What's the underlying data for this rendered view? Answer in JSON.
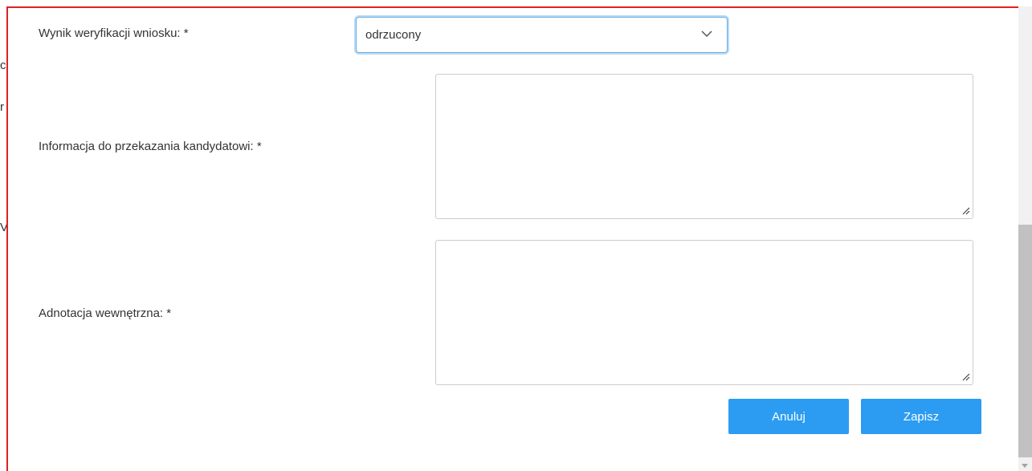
{
  "form": {
    "verification_label": "Wynik weryfikacji wniosku: *",
    "verification_select": {
      "selected": "odrzucony",
      "icon": "chevron-down-icon"
    },
    "candidate_info_label": "Informacja do przekazania kandydatowi: *",
    "candidate_info_value": "",
    "internal_note_label": "Adnotacja wewnętrzna: *",
    "internal_note_value": ""
  },
  "actions": {
    "cancel_label": "Anuluj",
    "save_label": "Zapisz"
  },
  "background": {
    "partial_chars": [
      "c",
      "r",
      "V"
    ]
  },
  "colors": {
    "accent": "#2b9cf2",
    "dialog_border": "#e02020",
    "focus_border": "#66afe9"
  }
}
